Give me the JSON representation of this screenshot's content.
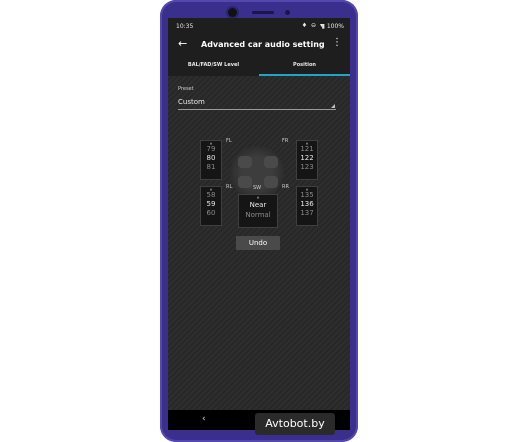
{
  "status_bar": {
    "time": "10:35",
    "icons": "♦ ⊖ ▾",
    "battery": "▮ 100%"
  },
  "app_bar": {
    "back_icon": "←",
    "title": "Advanced car audio setting",
    "more_icon": "⋮"
  },
  "tabs": [
    {
      "label": "BAL/FAD/SW Level",
      "selected": false
    },
    {
      "label": "Position",
      "selected": true
    }
  ],
  "accent_color": "#1fa5c8",
  "preset": {
    "label": "Preset",
    "value": "Custom"
  },
  "channels": {
    "fl": {
      "label": "FL",
      "prev": "79",
      "value": "80",
      "next": "81"
    },
    "fr": {
      "label": "FR",
      "prev": "121",
      "value": "122",
      "next": "123"
    },
    "rl": {
      "label": "RL",
      "prev": "58",
      "value": "59",
      "next": "60"
    },
    "rr": {
      "label": "RR",
      "prev": "135",
      "value": "136",
      "next": "137"
    },
    "sw": {
      "label": "SW",
      "value": "Near",
      "next": "Normal"
    }
  },
  "undo_label": "Undo",
  "watermark": "Avtobot.by"
}
